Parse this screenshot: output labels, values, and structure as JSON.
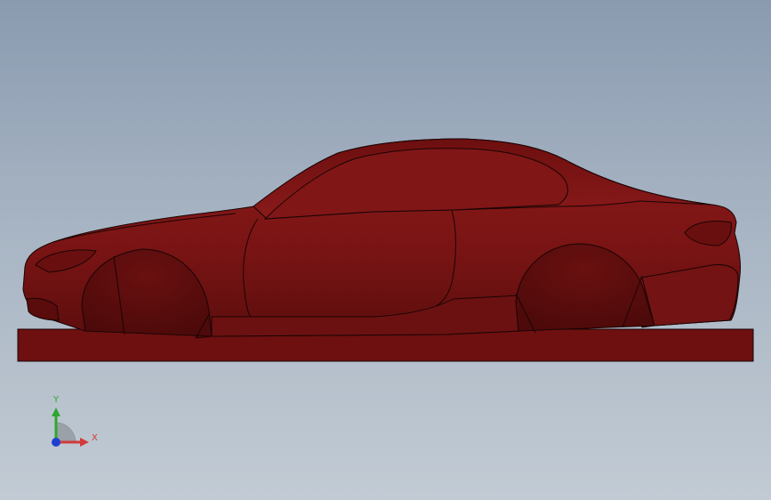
{
  "viewport": {
    "background_top": "#8a9bb0",
    "background_bottom": "#c2cbd4"
  },
  "model": {
    "body_color": "#7a1414",
    "base_color": "#6e1010",
    "edge_color": "#1a0404"
  },
  "triad": {
    "x_label": "X",
    "y_label": "Y",
    "x_color": "#d23a3a",
    "y_color": "#2fa62f",
    "z_color": "#1f3fd1"
  }
}
